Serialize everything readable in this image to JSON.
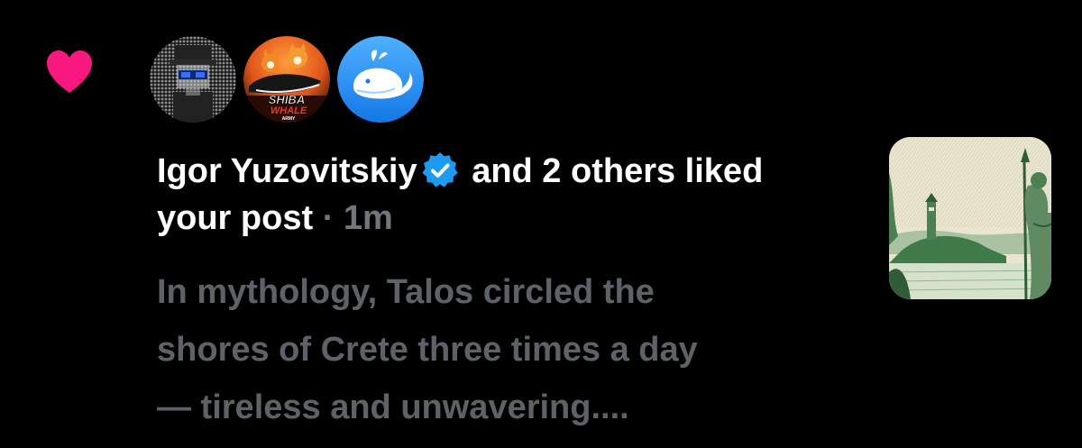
{
  "notification": {
    "icon": "heart-icon",
    "icon_color": "#f91880",
    "avatars": [
      {
        "name": "avatar-pixel-figure"
      },
      {
        "name": "avatar-shiba-whale",
        "text_top": "SHIBA",
        "text_mid": "WHALE",
        "text_bottom": "ARMY"
      },
      {
        "name": "avatar-blue-whale",
        "color": "#1d9bf0"
      }
    ],
    "headline": {
      "user": "Igor Yuzovitskiy",
      "action": "and 2 others liked",
      "object": "your post",
      "separator": "·",
      "time": "1m"
    },
    "preview": {
      "line1": "In mythology, Talos circled the",
      "line2": "shores of Crete three times a day",
      "line3": "— tireless and unwavering...."
    },
    "verified_color": "#1d9bf0",
    "thumbnail": "post-thumbnail-lighthouse-warrior"
  }
}
